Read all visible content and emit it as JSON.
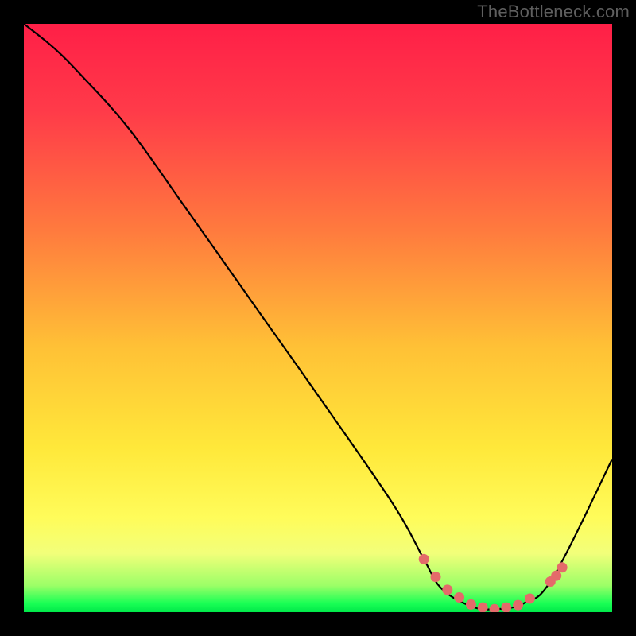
{
  "watermark": "TheBottleneck.com",
  "colors": {
    "frame": "#000000",
    "gradient_stops": [
      {
        "offset": 0.0,
        "color": "#ff1f47"
      },
      {
        "offset": 0.15,
        "color": "#ff3b49"
      },
      {
        "offset": 0.35,
        "color": "#ff7a3e"
      },
      {
        "offset": 0.55,
        "color": "#ffc136"
      },
      {
        "offset": 0.72,
        "color": "#ffe83a"
      },
      {
        "offset": 0.84,
        "color": "#fffc5a"
      },
      {
        "offset": 0.9,
        "color": "#f2ff7a"
      },
      {
        "offset": 0.955,
        "color": "#9bff67"
      },
      {
        "offset": 0.985,
        "color": "#1aff55"
      },
      {
        "offset": 1.0,
        "color": "#00e84a"
      }
    ],
    "curve": "#000000",
    "marker": "#e46a6a"
  },
  "chart_data": {
    "type": "line",
    "title": "",
    "xlabel": "",
    "ylabel": "",
    "xlim": [
      0,
      100
    ],
    "ylim": [
      0,
      100
    ],
    "series": [
      {
        "name": "bottleneck-curve",
        "x": [
          0,
          5,
          10,
          18,
          28,
          40,
          52,
          63,
          68,
          71,
          76,
          80,
          85,
          90,
          100
        ],
        "y": [
          100,
          96,
          91,
          82,
          68,
          51,
          34,
          18,
          9,
          4,
          1,
          0.5,
          1.5,
          6,
          26
        ]
      }
    ],
    "markers": {
      "name": "optimal-range",
      "x": [
        68,
        70,
        72,
        74,
        76,
        78,
        80,
        82,
        84,
        86,
        89.5,
        90.5,
        91.5
      ],
      "y": [
        9,
        6,
        3.8,
        2.5,
        1.3,
        0.8,
        0.5,
        0.8,
        1.2,
        2.3,
        5.2,
        6.2,
        7.6
      ]
    }
  }
}
